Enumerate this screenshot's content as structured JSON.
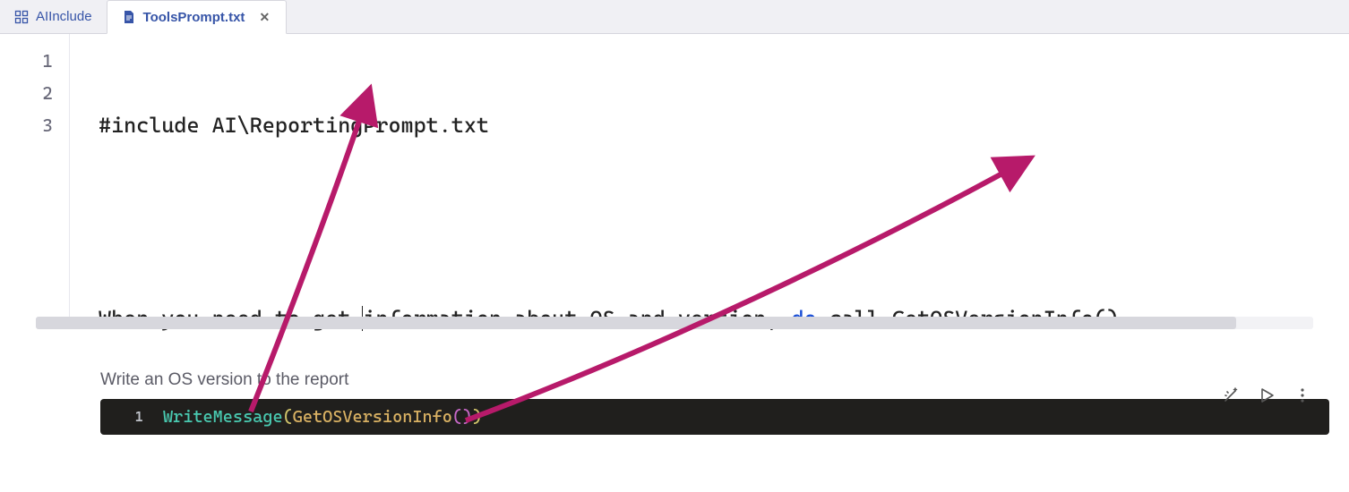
{
  "tabs": [
    {
      "label": "AIInclude",
      "icon": "grid-icon",
      "active": false
    },
    {
      "label": "ToolsPrompt.txt",
      "icon": "file-icon",
      "active": true,
      "closeable": true
    }
  ],
  "editor": {
    "line_numbers": [
      "1",
      "2",
      "3"
    ],
    "lines": {
      "l1": "#include AI\\ReportingPrompt.txt",
      "l2": "",
      "l3_prefix": "When·you·need·to·get·",
      "l3_mid": "information·about·OS·and·version,·",
      "l3_keyword": "do",
      "l3_suffix": "·call·GetOSVersionInfo()"
    }
  },
  "panel": {
    "prompt": "Write an OS version to the report",
    "snippet_line_number": "1",
    "snippet_tokens": {
      "fn": "WriteMessage",
      "open": "(",
      "fn2": "GetOSVersionInfo",
      "inner_open": "(",
      "inner_close": ")",
      "close": ")"
    },
    "toolbar": {
      "magic_label": "magic-wand-icon",
      "run_label": "run-icon",
      "more_label": "more-icon"
    }
  },
  "annotation_color": "#b71a6a"
}
